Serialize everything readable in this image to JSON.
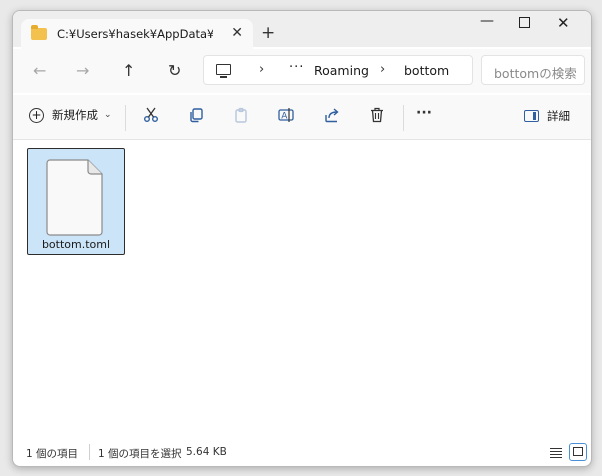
{
  "window": {
    "tab_title": "C:¥Users¥hasek¥AppData¥Roaming¥bottom",
    "tab_close": "✕",
    "new_tab": "+",
    "minimize": "—",
    "close": "✕"
  },
  "nav": {
    "back": "←",
    "forward": "→",
    "up": "↑",
    "refresh": "↻",
    "more": "···",
    "separator": "›",
    "crumbs": [
      "Roaming",
      "bottom"
    ],
    "search_placeholder": "bottomの検索"
  },
  "commands": {
    "new_label": "新規作成",
    "new_caret": "⌄",
    "more": "···",
    "details_label": "詳細",
    "icons": [
      "cut-icon",
      "copy-icon",
      "paste-icon",
      "rename-icon",
      "share-icon",
      "delete-icon"
    ]
  },
  "files": [
    {
      "name": "bottom.toml",
      "selected": true
    }
  ],
  "status": {
    "item_count": "1 個の項目",
    "selected_count": "1 個の項目を選択",
    "size": "5.64 KB"
  },
  "colors": {
    "accent": "#2f5f9f",
    "selection": "#cce4f7",
    "folder": "#f2c14e"
  }
}
